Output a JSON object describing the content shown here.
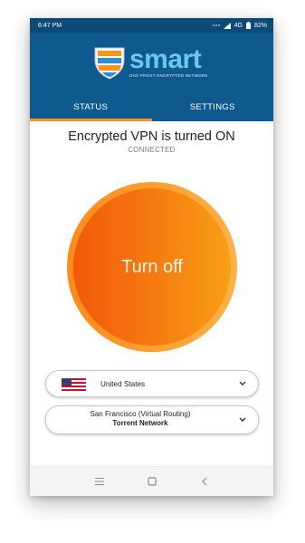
{
  "statusbar": {
    "time": "6:47 PM",
    "network": "4G",
    "battery": "82%",
    "icons": [
      "dots-icon",
      "signal-icon",
      "battery-icon"
    ]
  },
  "header": {
    "brand": "smart",
    "tagline": "DNS PROXY ENCRYPTED NETWORK"
  },
  "tabs": [
    {
      "label": "STATUS",
      "active": true
    },
    {
      "label": "SETTINGS",
      "active": false
    }
  ],
  "main": {
    "status_title": "Encrypted VPN is turned ON",
    "connection_state": "CONNECTED",
    "toggle_label": "Turn off",
    "country": {
      "value": "United States",
      "flag": "us-flag-icon"
    },
    "server": {
      "name": "San Francisco (Virtual Routing)",
      "network": "Torrent Network"
    }
  },
  "navbar": {
    "icons": [
      "menu-icon",
      "home-square-icon",
      "back-icon"
    ]
  },
  "colors": {
    "header": "#0e5a8e",
    "statusbar": "#0d4a78",
    "accent": "#f7941d",
    "button_start": "#f25a0a",
    "button_end": "#f8a015"
  }
}
